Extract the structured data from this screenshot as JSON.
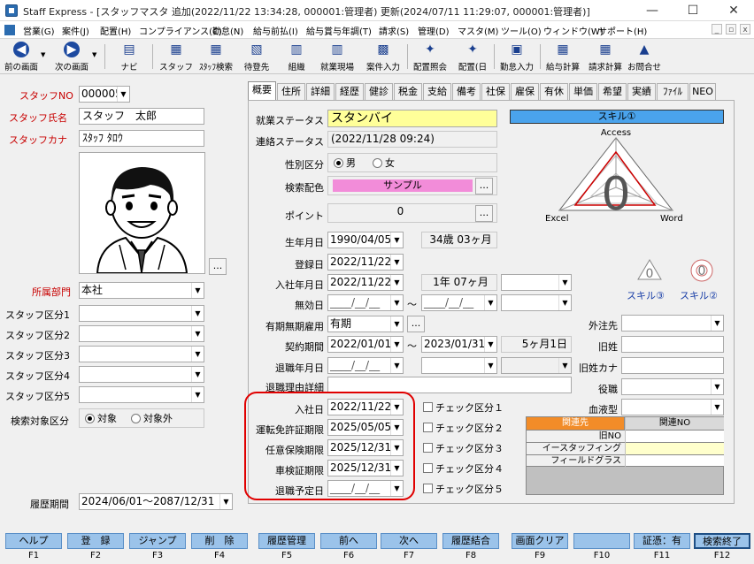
{
  "window": {
    "title": "Staff Express - [スタッフマスタ  追加(2022/11/22 13:34:28, 000001:管理者) 更新(2024/07/11 11:29:07, 000001:管理者)]",
    "minimize": "—",
    "maximize": "☐",
    "close": "✕"
  },
  "menu": [
    "営業(G)",
    "案件(J)",
    "配置(H)",
    "コンプライアンス(C)",
    "勤怠(N)",
    "給与前払(I)",
    "給与賞与年調(T)",
    "請求(S)",
    "管理(D)",
    "マスタ(M)",
    "ツール(O)",
    "ウィンドウ(W)",
    "サポート(H)"
  ],
  "mdi": {
    "min": "_",
    "restore": "▫",
    "close": "x"
  },
  "toolbar": [
    {
      "label": "前の画面",
      "icon": "back-arrow-icon",
      "glyph": "◀"
    },
    {
      "label": "次の画面",
      "icon": "forward-arrow-icon",
      "glyph": "▶"
    },
    {
      "label": "ナビ",
      "icon": "navi-icon",
      "glyph": "▤"
    },
    {
      "label": "スタッフ",
      "icon": "staff-icon",
      "glyph": "▦"
    },
    {
      "label": "ｽﾀｯﾌ検索",
      "icon": "staff-search-icon",
      "glyph": "▦"
    },
    {
      "label": "待登先",
      "icon": "waiting-icon",
      "glyph": "▧"
    },
    {
      "label": "組織",
      "icon": "organization-icon",
      "glyph": "▥"
    },
    {
      "label": "就業現場",
      "icon": "workplace-icon",
      "glyph": "▥"
    },
    {
      "label": "案件入力",
      "icon": "case-input-icon",
      "glyph": "▩"
    },
    {
      "label": "配置照会",
      "icon": "placement-inquiry-icon",
      "glyph": "✦"
    },
    {
      "label": "配置(日",
      "icon": "placement-daily-icon",
      "glyph": "✦"
    },
    {
      "label": "勤怠入力",
      "icon": "attendance-input-icon",
      "glyph": "▣"
    },
    {
      "label": "給与計算",
      "icon": "payroll-icon",
      "glyph": "▦"
    },
    {
      "label": "請求計算",
      "icon": "billing-icon",
      "glyph": "▦"
    },
    {
      "label": "お問合せ",
      "icon": "inquiry-icon",
      "glyph": "▲"
    }
  ],
  "left": {
    "staff_no_label": "スタッフNO",
    "staff_no": "000005",
    "staff_name_label": "スタッフ氏名",
    "staff_name": "スタッフ　太郎",
    "staff_kana_label": "スタッフカナ",
    "staff_kana": "ｽﾀｯﾌ ﾀﾛｳ",
    "photo_button": "...",
    "dept_label": "所属部門",
    "dept": "本社",
    "categories": [
      {
        "label": "スタッフ区分1",
        "value": ""
      },
      {
        "label": "スタッフ区分2",
        "value": ""
      },
      {
        "label": "スタッフ区分3",
        "value": ""
      },
      {
        "label": "スタッフ区分4",
        "value": ""
      },
      {
        "label": "スタッフ区分5",
        "value": ""
      }
    ],
    "search_target_label": "検索対象区分",
    "search_target_on": "対象",
    "search_target_off": "対象外",
    "history_label": "履歴期間",
    "history": "2024/06/01～2087/12/31"
  },
  "tabs": [
    "概要",
    "住所",
    "詳細",
    "経歴",
    "健診",
    "税金",
    "支給",
    "備考",
    "社保",
    "雇保",
    "有休",
    "単価",
    "希望",
    "実績",
    "ﾌｧｲﾙ",
    "NEO"
  ],
  "overview": {
    "work_status_label": "就業ステータス",
    "work_status": "スタンバイ",
    "contact_status_label": "連絡ステータス",
    "contact_status": "(2022/11/28 09:24)",
    "gender_label": "性別区分",
    "gender_male": "男",
    "gender_female": "女",
    "search_color_label": "検索配色",
    "search_color_value": "サンプル",
    "search_color": "#f28cd9",
    "point_label": "ポイント",
    "point": "0",
    "birth_label": "生年月日",
    "birth": "1990/04/05",
    "age": "34歳 03ヶ月",
    "register_label": "登録日",
    "register": "2022/11/22",
    "hire_label": "入社年月日",
    "hire": "2022/11/22",
    "tenure": "1年 07ヶ月",
    "invalid_label": "無効日",
    "invalid_from": "____/__/__",
    "invalid_to": "____/__/__",
    "tilde": "～",
    "contract_type_label": "有期無期雇用",
    "contract_type": "有期",
    "contract_period_label": "契約期間",
    "contract_from": "2022/01/01",
    "contract_to": "2023/01/31",
    "contract_len": "5ヶ月1日",
    "retire_label": "退職年月日",
    "retire": "____/__/__",
    "retire_reason_label": "退職理由詳細",
    "join_label": "入社日",
    "join": "2022/11/22",
    "license_label": "運転免許証期限",
    "license": "2025/05/05",
    "insurance_label": "任意保険期限",
    "insurance": "2025/12/31",
    "vehicle_label": "車検証期限",
    "vehicle": "2025/12/31",
    "retire_plan_label": "退職予定日",
    "retire_plan": "____/__/__",
    "checks": [
      "チェック区分１",
      "チェック区分２",
      "チェック区分３",
      "チェック区分４",
      "チェック区分５"
    ],
    "outsource_label": "外注先",
    "old_name_label": "旧姓",
    "old_kana_label": "旧姓カナ",
    "position_label": "役職",
    "blood_label": "血液型"
  },
  "skill": {
    "header": "スキル①",
    "axes": [
      "Access",
      "Excel",
      "Word"
    ],
    "center_value": "0",
    "skill3": "スキル③",
    "skill2": "スキル②"
  },
  "related": {
    "col1": "関連先",
    "col2": "関連NO",
    "rows": [
      "旧NO",
      "イースタッフィング",
      "フィールドグラス"
    ],
    "header_color": "#f28c28"
  },
  "fkeys": [
    {
      "label": "ヘルプ",
      "key": "F1"
    },
    {
      "label": "登　録",
      "key": "F2"
    },
    {
      "label": "ジャンプ",
      "key": "F3"
    },
    {
      "label": "削　除",
      "key": "F4"
    },
    {
      "label": "履歴管理",
      "key": "F5"
    },
    {
      "label": "前へ",
      "key": "F6"
    },
    {
      "label": "次へ",
      "key": "F7"
    },
    {
      "label": "履歴結合",
      "key": "F8"
    },
    {
      "label": "画面クリア",
      "key": "F9"
    },
    {
      "label": "",
      "key": "F10"
    },
    {
      "label": "証憑：有",
      "key": "F11"
    },
    {
      "label": "検索終了",
      "key": "F12"
    }
  ]
}
